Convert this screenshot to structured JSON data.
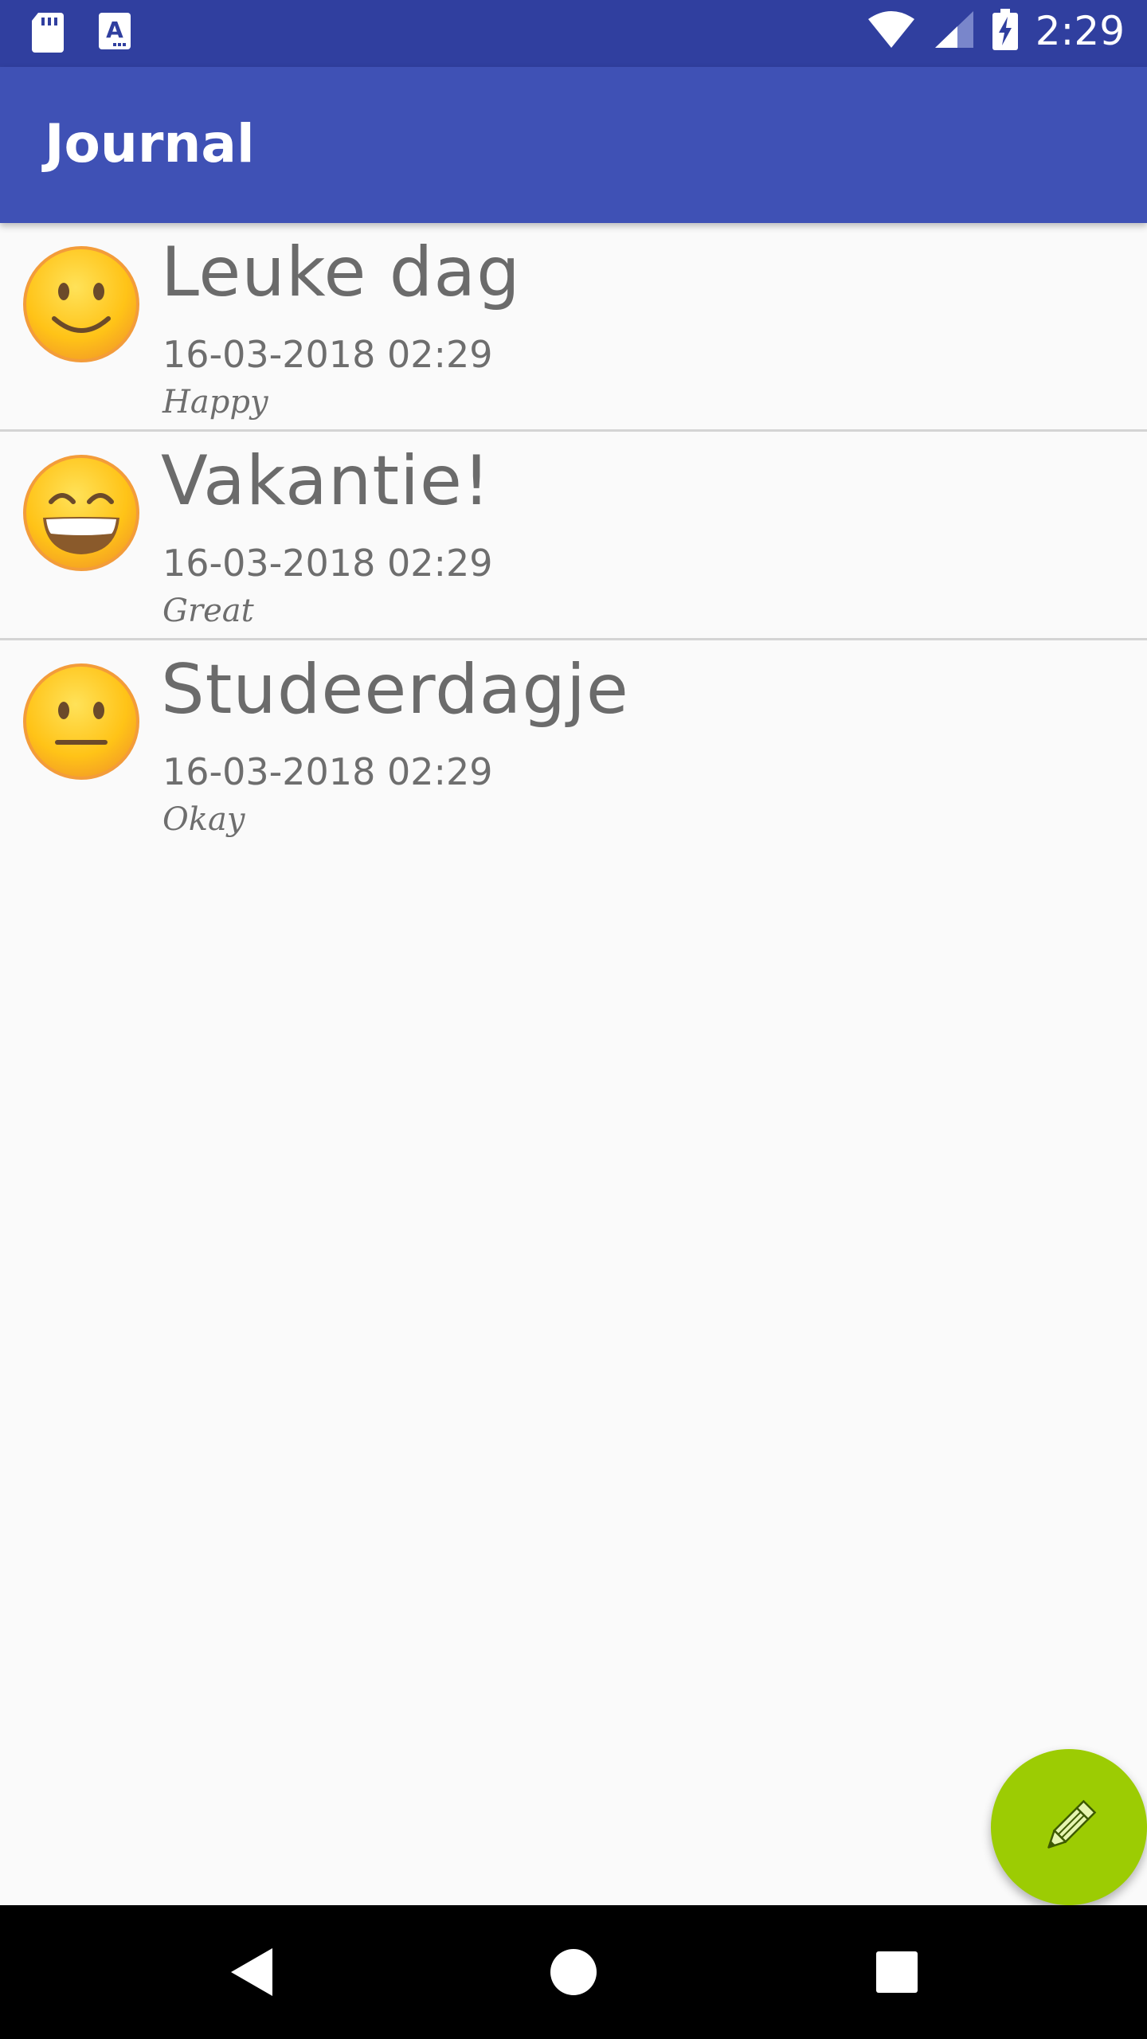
{
  "status_bar": {
    "time": "2:29",
    "icons": [
      "sd-card-icon",
      "font-app-icon",
      "wifi-icon",
      "cell-signal-icon",
      "battery-charging-icon"
    ]
  },
  "app_bar": {
    "title": "Journal"
  },
  "entries": [
    {
      "title": "Leuke dag",
      "date": "16-03-2018 02:29",
      "mood": "Happy",
      "emoji": "smile-emoji-icon"
    },
    {
      "title": "Vakantie!",
      "date": "16-03-2018 02:29",
      "mood": "Great",
      "emoji": "grin-emoji-icon"
    },
    {
      "title": "Studeerdagje",
      "date": "16-03-2018 02:29",
      "mood": "Okay",
      "emoji": "neutral-emoji-icon"
    }
  ],
  "fab": {
    "icon": "pencil-icon"
  },
  "nav_bar": {
    "icons": [
      "back-icon",
      "home-icon",
      "recents-icon"
    ]
  },
  "colors": {
    "status_bar": "#303f9f",
    "app_bar": "#3f51b5",
    "fab": "#9ccc03",
    "background": "#fafafa"
  }
}
